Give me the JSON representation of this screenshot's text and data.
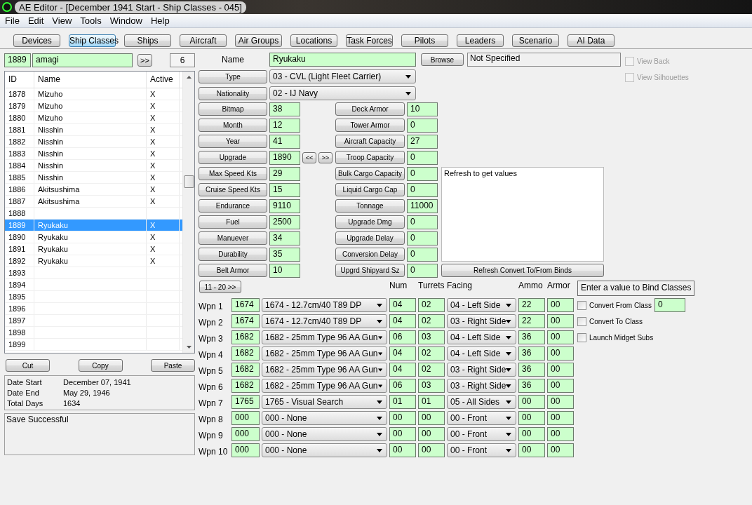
{
  "window": {
    "title": "AE Editor - [December 1941 Start - Ship Classes - 045]"
  },
  "menu": [
    "File",
    "Edit",
    "View",
    "Tools",
    "Window",
    "Help"
  ],
  "toolbar": [
    {
      "label": "Devices",
      "selected": false
    },
    {
      "label": "Ship Classes",
      "selected": true
    },
    {
      "label": "Ships",
      "selected": false
    },
    {
      "label": "Aircraft",
      "selected": false
    },
    {
      "label": "Air Groups",
      "selected": false
    },
    {
      "label": "Locations",
      "selected": false
    },
    {
      "label": "Task Forces",
      "selected": false
    },
    {
      "label": "Pilots",
      "selected": false
    },
    {
      "label": "Leaders",
      "selected": false
    },
    {
      "label": "Scenario",
      "selected": false
    },
    {
      "label": "AI Data",
      "selected": false
    }
  ],
  "search": {
    "id": "1889",
    "name": "amagi",
    "next_button": ">>",
    "count": "6"
  },
  "class_list": {
    "columns": [
      "ID",
      "Name",
      "Active"
    ],
    "rows": [
      {
        "id": "1878",
        "name": "Mizuho",
        "active": "X",
        "selected": false
      },
      {
        "id": "1879",
        "name": "Mizuho",
        "active": "X",
        "selected": false
      },
      {
        "id": "1880",
        "name": "Mizuho",
        "active": "X",
        "selected": false
      },
      {
        "id": "1881",
        "name": "Nisshin",
        "active": "X",
        "selected": false
      },
      {
        "id": "1882",
        "name": "Nisshin",
        "active": "X",
        "selected": false
      },
      {
        "id": "1883",
        "name": "Nisshin",
        "active": "X",
        "selected": false
      },
      {
        "id": "1884",
        "name": "Nisshin",
        "active": "X",
        "selected": false
      },
      {
        "id": "1885",
        "name": "Nisshin",
        "active": "X",
        "selected": false
      },
      {
        "id": "1886",
        "name": "Akitsushima",
        "active": "X",
        "selected": false
      },
      {
        "id": "1887",
        "name": "Akitsushima",
        "active": "X",
        "selected": false
      },
      {
        "id": "1888",
        "selected": false
      },
      {
        "id": "1889",
        "name": "Ryukaku",
        "active": "X",
        "selected": true
      },
      {
        "id": "1890",
        "name": "Ryukaku",
        "active": "X",
        "selected": false
      },
      {
        "id": "1891",
        "name": "Ryukaku",
        "active": "X",
        "selected": false
      },
      {
        "id": "1892",
        "name": "Ryukaku",
        "active": "X",
        "selected": false
      },
      {
        "id": "1893",
        "selected": false
      },
      {
        "id": "1894",
        "selected": false
      },
      {
        "id": "1895",
        "selected": false
      },
      {
        "id": "1896",
        "selected": false
      },
      {
        "id": "1897",
        "selected": false
      },
      {
        "id": "1898",
        "selected": false
      },
      {
        "id": "1899",
        "selected": false
      }
    ]
  },
  "clipboard_buttons": [
    "Cut",
    "Copy",
    "Paste"
  ],
  "scenario_info": [
    {
      "label": "Date Start",
      "value": "December 07, 1941"
    },
    {
      "label": "Date End",
      "value": "May 29, 1946"
    },
    {
      "label": "Total Days",
      "value": "1634"
    }
  ],
  "status_message": "Save Successful",
  "name_field": {
    "label": "Name",
    "value": "Ryukaku"
  },
  "browse_button": "Browse",
  "bitmap_file": "Not Specified",
  "view_options": [
    {
      "label": "View Back",
      "checked": false,
      "disabled": true
    },
    {
      "label": "View Silhouettes",
      "checked": false,
      "disabled": true
    }
  ],
  "selectors": [
    {
      "label": "Type",
      "value": "03 - CVL (Light Fleet Carrier)"
    },
    {
      "label": "Nationality",
      "value": "02 - IJ Navy"
    }
  ],
  "stats_left": [
    {
      "label": "Bitmap",
      "value": "38"
    },
    {
      "label": "Month",
      "value": "12"
    },
    {
      "label": "Year",
      "value": "41"
    },
    {
      "label": "Upgrade",
      "value": "1890",
      "arrows": [
        "<<",
        ">>"
      ]
    },
    {
      "label": "Max Speed Kts",
      "value": "29"
    },
    {
      "label": "Cruise Speed Kts",
      "value": "15"
    },
    {
      "label": "Endurance",
      "value": "9110"
    },
    {
      "label": "Fuel",
      "value": "2500"
    },
    {
      "label": "Manuever",
      "value": "34"
    },
    {
      "label": "Durability",
      "value": "35"
    },
    {
      "label": "Belt Armor",
      "value": "10"
    }
  ],
  "stats_right": [
    {
      "label": "Deck Armor",
      "value": "10"
    },
    {
      "label": "Tower Armor",
      "value": "0"
    },
    {
      "label": "Aircraft Capacity",
      "value": "27"
    },
    {
      "label": "Troop Capacity",
      "value": "0"
    },
    {
      "label": "Bulk Cargo Capacity",
      "value": "0"
    },
    {
      "label": "Liquid Cargo Cap",
      "value": "0"
    },
    {
      "label": "Tonnage",
      "value": "11000"
    },
    {
      "label": "Upgrade Dmg",
      "value": "0"
    },
    {
      "label": "Upgrade Delay",
      "value": "0"
    },
    {
      "label": "Conversion Delay",
      "value": "0"
    },
    {
      "label": "Upgrd Shipyard Sz",
      "value": "0"
    }
  ],
  "refresh_output": "Refresh to get values",
  "refresh_button": "Refresh Convert To/From Binds",
  "weapons": {
    "page_button": "11 - 20 >>",
    "columns": [
      "Num",
      "Turrets",
      "Facing",
      "Ammo",
      "Armor"
    ],
    "rows": [
      {
        "label": "Wpn 1",
        "id": "1674",
        "device": "1674 - 12.7cm/40 T89 DP",
        "num": "04",
        "turrets": "02",
        "facing": "04 - Left Side",
        "ammo": "22",
        "armor": "00"
      },
      {
        "label": "Wpn 2",
        "id": "1674",
        "device": "1674 - 12.7cm/40 T89 DP",
        "num": "04",
        "turrets": "02",
        "facing": "03 - Right Side",
        "ammo": "22",
        "armor": "00"
      },
      {
        "label": "Wpn 3",
        "id": "1682",
        "device": "1682 - 25mm Type 96 AA Gun",
        "num": "06",
        "turrets": "03",
        "facing": "04 - Left Side",
        "ammo": "36",
        "armor": "00"
      },
      {
        "label": "Wpn 4",
        "id": "1682",
        "device": "1682 - 25mm Type 96 AA Gun",
        "num": "04",
        "turrets": "02",
        "facing": "04 - Left Side",
        "ammo": "36",
        "armor": "00"
      },
      {
        "label": "Wpn 5",
        "id": "1682",
        "device": "1682 - 25mm Type 96 AA Gun",
        "num": "04",
        "turrets": "02",
        "facing": "03 - Right Side",
        "ammo": "36",
        "armor": "00"
      },
      {
        "label": "Wpn 6",
        "id": "1682",
        "device": "1682 - 25mm Type 96 AA Gun",
        "num": "06",
        "turrets": "03",
        "facing": "03 - Right Side",
        "ammo": "36",
        "armor": "00"
      },
      {
        "label": "Wpn 7",
        "id": "1765",
        "device": "1765 - Visual Search",
        "num": "01",
        "turrets": "01",
        "facing": "05 - All Sides",
        "ammo": "00",
        "armor": "00"
      },
      {
        "label": "Wpn 8",
        "id": "000",
        "device": "000 - None",
        "num": "00",
        "turrets": "00",
        "facing": "00 - Front",
        "ammo": "00",
        "armor": "00"
      },
      {
        "label": "Wpn 9",
        "id": "000",
        "device": "000 - None",
        "num": "00",
        "turrets": "00",
        "facing": "00 - Front",
        "ammo": "00",
        "armor": "00"
      },
      {
        "label": "Wpn 10",
        "id": "000",
        "device": "000 - None",
        "num": "00",
        "turrets": "00",
        "facing": "00 - Front",
        "ammo": "00",
        "armor": "00"
      }
    ]
  },
  "bind": {
    "title": "Enter a value to Bind Classes",
    "options": [
      {
        "label": "Convert From Class",
        "checked": false,
        "value": "0"
      },
      {
        "label": "Convert To Class",
        "checked": false
      },
      {
        "label": "Launch Midget Subs",
        "checked": false
      }
    ]
  }
}
